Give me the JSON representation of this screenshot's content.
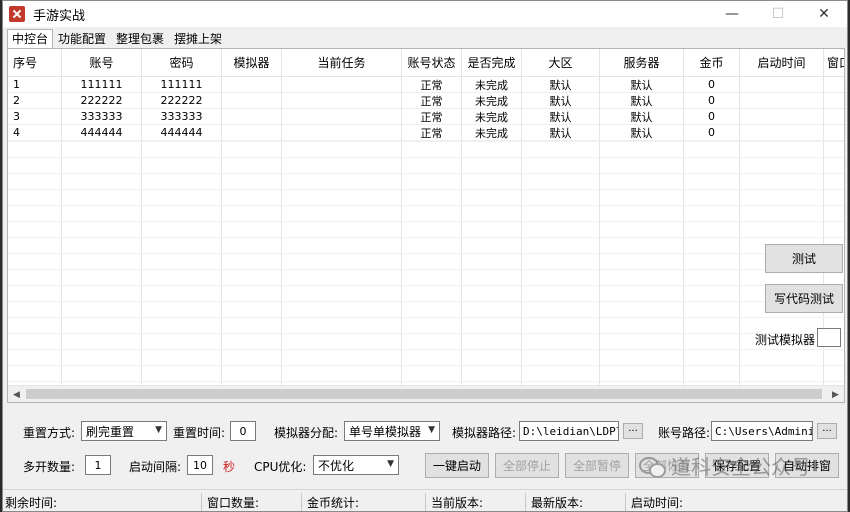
{
  "window": {
    "title": "手游实战",
    "minimize": "—",
    "maximize": "☐",
    "close": "✕"
  },
  "tabs": [
    {
      "label": "中控台",
      "active": true
    },
    {
      "label": "功能配置",
      "active": false
    },
    {
      "label": "整理包裹",
      "active": false
    },
    {
      "label": "摆摊上架",
      "active": false
    }
  ],
  "grid": {
    "columns": [
      "序号",
      "账号",
      "密码",
      "模拟器",
      "当前任务",
      "账号状态",
      "是否完成",
      "大区",
      "服务器",
      "金币",
      "启动时间",
      "窗口"
    ],
    "rows": [
      {
        "seq": "1",
        "account": "111111",
        "password": "111111",
        "simulator": "",
        "task": "",
        "status": "正常",
        "done": "未完成",
        "region": "默认",
        "server": "默认",
        "gold": "0",
        "time": "",
        "window": ""
      },
      {
        "seq": "2",
        "account": "222222",
        "password": "222222",
        "simulator": "",
        "task": "",
        "status": "正常",
        "done": "未完成",
        "region": "默认",
        "server": "默认",
        "gold": "0",
        "time": "",
        "window": ""
      },
      {
        "seq": "3",
        "account": "333333",
        "password": "333333",
        "simulator": "",
        "task": "",
        "status": "正常",
        "done": "未完成",
        "region": "默认",
        "server": "默认",
        "gold": "0",
        "time": "",
        "window": ""
      },
      {
        "seq": "4",
        "account": "444444",
        "password": "444444",
        "simulator": "",
        "task": "",
        "status": "正常",
        "done": "未完成",
        "region": "默认",
        "server": "默认",
        "gold": "0",
        "time": "",
        "window": ""
      }
    ]
  },
  "side": {
    "test_button": "测试",
    "code_test_button": "写代码测试",
    "test_simulator_label": "测试模拟器",
    "test_simulator_value": ""
  },
  "controls": {
    "reset_mode_label": "重置方式:",
    "reset_mode_value": "刷完重置",
    "reset_time_label": "重置时间:",
    "reset_time_value": "0",
    "sim_alloc_label": "模拟器分配:",
    "sim_alloc_value": "单号单模拟器",
    "sim_path_label": "模拟器路径:",
    "sim_path_value": "D:\\leidian\\LDPla",
    "account_path_label": "账号路径:",
    "account_path_value": "C:\\Users\\Adminis",
    "browse": "···",
    "multi_count_label": "多开数量:",
    "multi_count_value": "1",
    "start_interval_label": "启动间隔:",
    "start_interval_value": "10",
    "seconds_unit": "秒",
    "cpu_opt_label": "CPU优化:",
    "cpu_opt_value": "不优化",
    "one_key_start": "一键启动",
    "stop_all": "全部停止",
    "pause_all": "全部暂停",
    "resume_all": "全部恢复",
    "save_config": "保存配置",
    "auto_arrange": "自动排窗"
  },
  "status": {
    "remaining_time": "剩余时间:",
    "window_count": "窗口数量:",
    "gold_stats": "金币统计:",
    "current_version": "当前版本:",
    "latest_version": "最新版本:",
    "start_time": "启动时间:"
  },
  "watermark": "道科安全公众号"
}
